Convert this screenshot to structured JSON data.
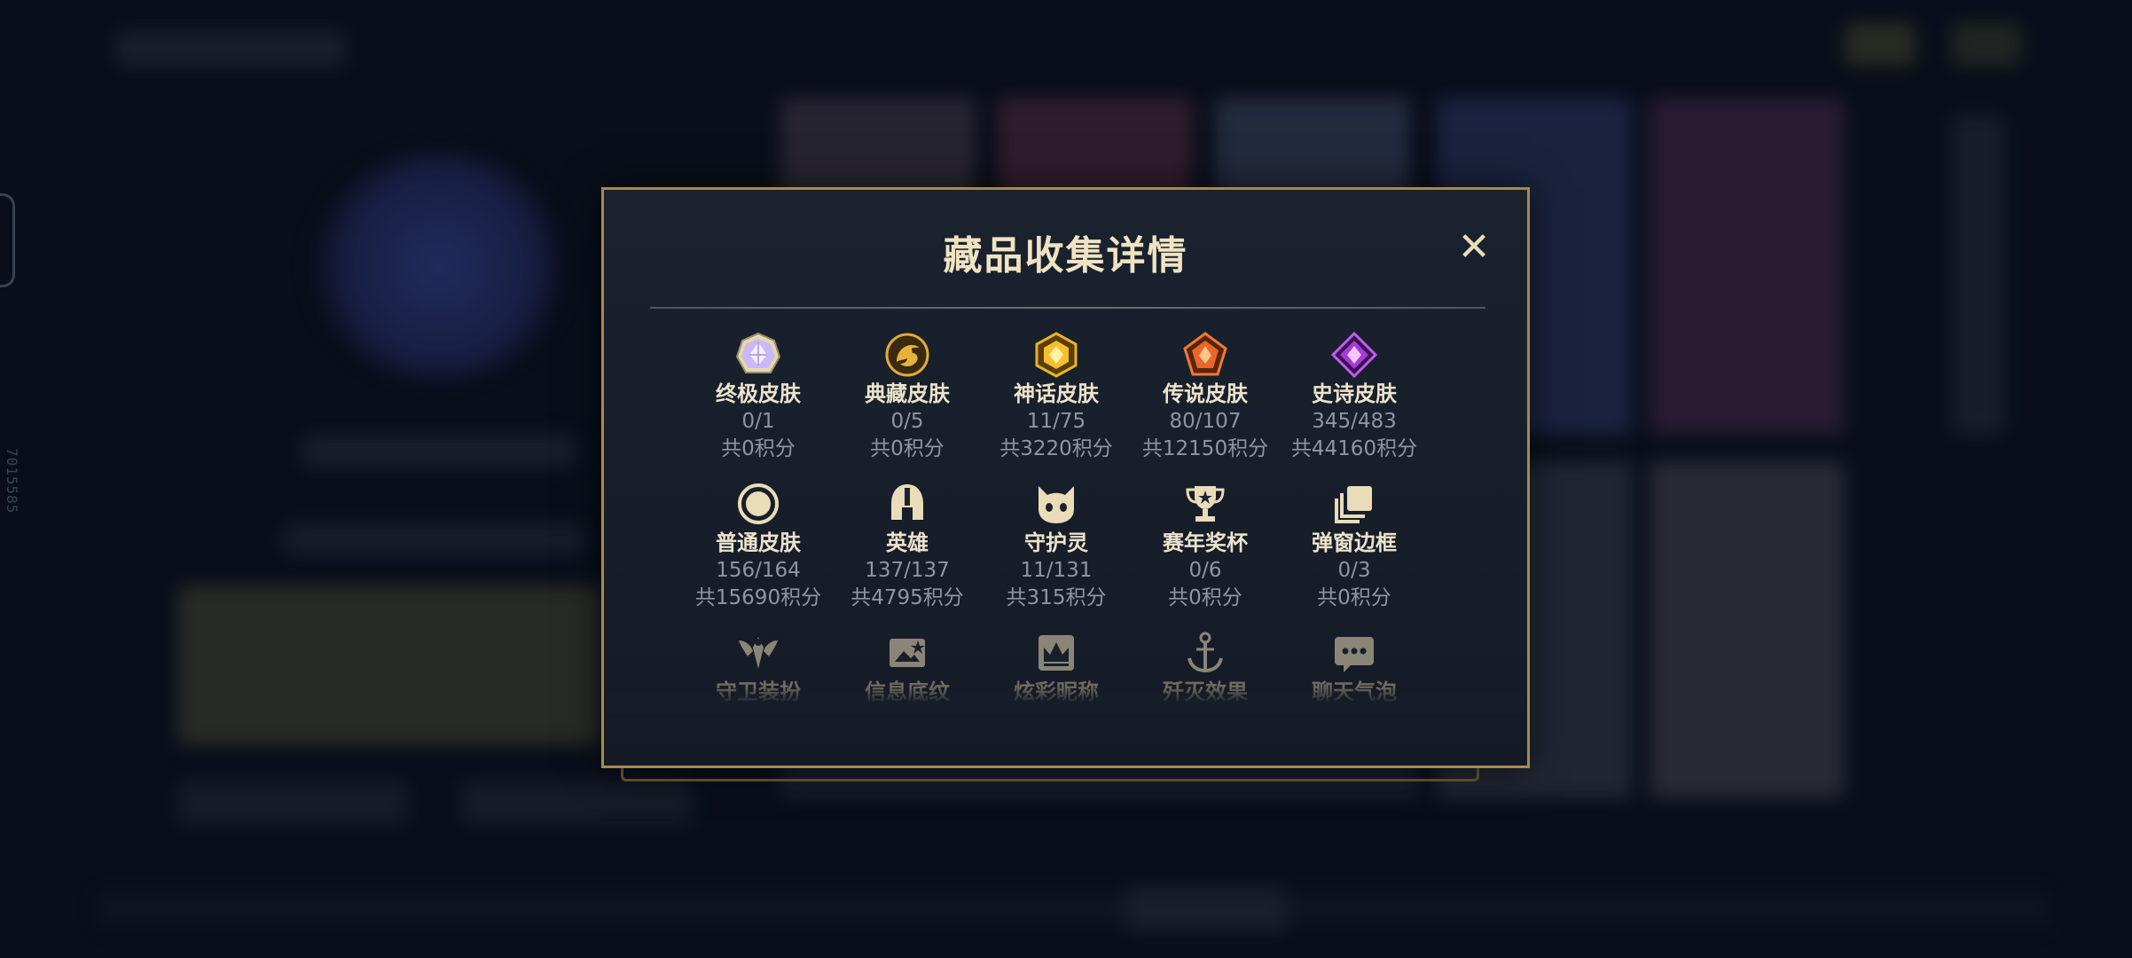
{
  "background": {
    "side_id": "7015585"
  },
  "modal": {
    "title": "藏品收集详情",
    "close_symbol": "✕",
    "rows": [
      [
        {
          "label": "终极皮肤",
          "count": "0/1",
          "points": "共0积分",
          "icon": "ultimate-skin-gem-icon",
          "color": "#b59cf0"
        },
        {
          "label": "典藏皮肤",
          "count": "0/5",
          "points": "共0积分",
          "icon": "prestige-skin-dragon-icon",
          "color": "#d9a531"
        },
        {
          "label": "神话皮肤",
          "count": "11/75",
          "points": "共3220积分",
          "icon": "mythic-skin-gem-icon",
          "color": "#e6b020"
        },
        {
          "label": "传说皮肤",
          "count": "80/107",
          "points": "共12150积分",
          "icon": "legendary-skin-gem-icon",
          "color": "#e8672a"
        },
        {
          "label": "史诗皮肤",
          "count": "345/483",
          "points": "共44160积分",
          "icon": "epic-skin-gem-icon",
          "color": "#a63ad6"
        }
      ],
      [
        {
          "label": "普通皮肤",
          "count": "156/164",
          "points": "共15690积分",
          "icon": "normal-skin-ring-icon",
          "color": "#e9dcb8"
        },
        {
          "label": "英雄",
          "count": "137/137",
          "points": "共4795积分",
          "icon": "champion-helmet-icon",
          "color": "#e9dcb8"
        },
        {
          "label": "守护灵",
          "count": "11/131",
          "points": "共315积分",
          "icon": "guardian-spirit-icon",
          "color": "#e9dcb8"
        },
        {
          "label": "赛年奖杯",
          "count": "0/6",
          "points": "共0积分",
          "icon": "season-trophy-icon",
          "color": "#e9dcb8"
        },
        {
          "label": "弹窗边框",
          "count": "0/3",
          "points": "共0积分",
          "icon": "popup-frame-icon",
          "color": "#e9dcb8"
        }
      ],
      [
        {
          "label": "守卫装扮",
          "icon": "ward-skin-icon",
          "color": "#e9dcb8"
        },
        {
          "label": "信息底纹",
          "icon": "info-card-icon",
          "color": "#e9dcb8"
        },
        {
          "label": "炫彩昵称",
          "icon": "colorful-nickname-icon",
          "color": "#e9dcb8"
        },
        {
          "label": "歼灭效果",
          "icon": "elimination-effect-icon",
          "color": "#e9dcb8"
        },
        {
          "label": "聊天气泡",
          "icon": "chat-bubble-icon",
          "color": "#e9dcb8"
        }
      ]
    ]
  }
}
